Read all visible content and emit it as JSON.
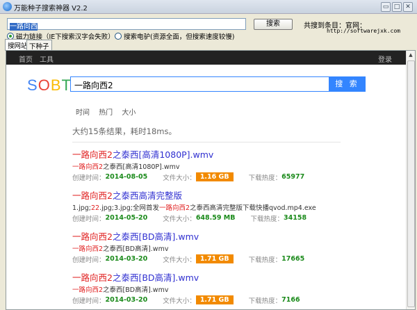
{
  "window": {
    "title": "万能种子搜索神器 V2.2",
    "min": "▭",
    "max": "□",
    "close": "✕"
  },
  "toolbar": {
    "query": "一路向西",
    "search_label": "搜索",
    "found_label": "共搜到条目：官网：",
    "site": "http://softwarejxk.com"
  },
  "modes": [
    {
      "label": "磁力链接（IE下搜索汉字会失败）",
      "selected": true
    },
    {
      "label": "搜索电驴(资源全面，但搜索速度较慢)",
      "selected": false
    }
  ],
  "tabs": [
    {
      "label": "搜网站",
      "active": true
    },
    {
      "label": "下种子",
      "active": false
    }
  ],
  "nav": {
    "home": "首页",
    "tools": "工具",
    "login": "登录"
  },
  "logo": {
    "letters": [
      "S",
      "O",
      "B",
      "T"
    ],
    "colors": [
      "#4285f4",
      "#ea4335",
      "#fbbc05",
      "#34a853"
    ]
  },
  "search": {
    "value": "一路向西2",
    "button": "搜 索"
  },
  "filters": [
    "时间",
    "热门",
    "大小"
  ],
  "result_count": "大约15条结果，耗时18ms。",
  "labels": {
    "created": "创建时间：",
    "size": "文件大小：",
    "heat": "下载热度："
  },
  "results": [
    {
      "title": [
        {
          "t": "一路向西2",
          "hl": true
        },
        {
          "t": "之泰西[高清1080P].wmv"
        }
      ],
      "desc": [
        {
          "t": "一路向西2",
          "hl": true
        },
        {
          "t": "之泰西[高清1080P].wmv"
        }
      ],
      "date": "2014-08-05",
      "size": "1.16 GB",
      "size_badge": true,
      "heat": "65977"
    },
    {
      "title": [
        {
          "t": "一路向西2",
          "hl": true
        },
        {
          "t": "之泰西高清完整版"
        }
      ],
      "desc": [
        {
          "t": "1.jpg;"
        },
        {
          "t": "22",
          "hl": true
        },
        {
          "t": ".jpg;3.jpg;全网首发"
        },
        {
          "t": "一路向西2",
          "hl": true
        },
        {
          "t": "之泰西高清完整版下载快播qvod.mp4.exe"
        }
      ],
      "date": "2014-05-20",
      "size": "648.59 MB",
      "size_badge": false,
      "heat": "34158"
    },
    {
      "title": [
        {
          "t": "一路向西2",
          "hl": true
        },
        {
          "t": "之泰西[BD高清].wmv"
        }
      ],
      "desc": [
        {
          "t": "一路向西2",
          "hl": true
        },
        {
          "t": "之泰西[BD高清].wmv"
        }
      ],
      "date": "2014-03-20",
      "size": "1.71 GB",
      "size_badge": true,
      "heat": "17665"
    },
    {
      "title": [
        {
          "t": "一路向西2",
          "hl": true
        },
        {
          "t": "之泰西[BD高清].wmv"
        }
      ],
      "desc": [
        {
          "t": "一路向西2",
          "hl": true
        },
        {
          "t": "之泰西[BD高清].wmv"
        }
      ],
      "date": "2014-03-20",
      "size": "1.71 GB",
      "size_badge": true,
      "heat": "7166"
    }
  ]
}
